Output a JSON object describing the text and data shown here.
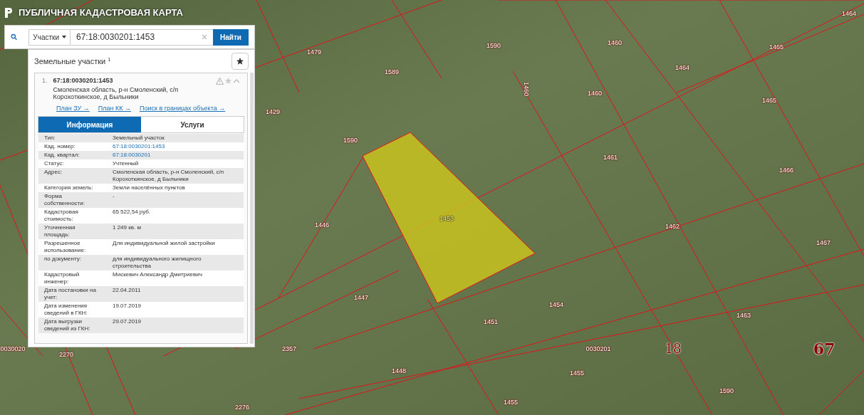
{
  "app": {
    "title": "ПУБЛИЧНАЯ КАДАСТРОВАЯ КАРТА"
  },
  "search": {
    "category": "Участки",
    "value": "67:18:0030201:1453",
    "button": "Найти"
  },
  "results": {
    "heading": "Земельные участки $^{1}$",
    "item": {
      "number": "1.",
      "cad_number": "67:18:0030201:1453",
      "address": "Смоленская область, р-н Смоленский, с/п Корохоткинское, д Быльники",
      "links": [
        "План ЗУ →",
        "План КК →",
        "Поиск в границах объекта →"
      ],
      "tabs": [
        {
          "label": "Информация",
          "selected": true
        },
        {
          "label": "Услуги",
          "selected": false
        }
      ],
      "rows": [
        {
          "label": "Тип:",
          "value": "Земельный участок",
          "kind": "text"
        },
        {
          "label": "Кад. номер:",
          "value": "67:18:0030201:1453",
          "kind": "link"
        },
        {
          "label": "Кад. квартал:",
          "value": "67:18:0030201",
          "kind": "link"
        },
        {
          "label": "Статус:",
          "value": "Учтенный",
          "kind": "text"
        },
        {
          "label": "Адрес:",
          "value": "Смоленская область, р-н Смоленский, с/п Корохоткинское, д Быльники",
          "kind": "text"
        },
        {
          "label": "Категория земель:",
          "value": "Земли населённых пунктов",
          "kind": "text"
        },
        {
          "label": "Форма собственности:",
          "value": "-",
          "kind": "text"
        },
        {
          "label": "Кадастровая стоимость:",
          "value": "65 522,54 руб.",
          "kind": "text"
        },
        {
          "label": "Уточненная площадь:",
          "value": "1 249 кв. м",
          "kind": "text"
        },
        {
          "label": "Разрешенное использование:",
          "value": "Для индивидуальной жилой застройки",
          "kind": "text"
        },
        {
          "label": "по документу:",
          "value": "для индивидуального жилищного строительства",
          "kind": "text"
        },
        {
          "label": "Кадастровый инженер:",
          "value": "Мискевич Александр Дмитриевич",
          "kind": "text"
        },
        {
          "label": "Дата постановки на учет:",
          "value": "22.04.2011",
          "kind": "text"
        },
        {
          "label": "Дата изменения сведений в ГКН:",
          "value": "19.07.2019",
          "kind": "text"
        },
        {
          "label": "Дата выгрузки сведений из ГКН:",
          "value": "29.07.2019",
          "kind": "text"
        }
      ]
    }
  },
  "map": {
    "parcel_labels": [
      {
        "text": "1464",
        "kind": "parcel"
      },
      {
        "text": "1460",
        "kind": "parcel"
      },
      {
        "text": "1465",
        "kind": "parcel"
      },
      {
        "text": "1590",
        "kind": "parcel"
      },
      {
        "text": "1479",
        "kind": "parcel"
      },
      {
        "text": "1589",
        "kind": "parcel"
      },
      {
        "text": "1464",
        "kind": "parcel"
      },
      {
        "text": "1429",
        "kind": "parcel"
      },
      {
        "text": "1460",
        "kind": "parcel"
      },
      {
        "text": "1460",
        "kind": "parcel"
      },
      {
        "text": "1465",
        "kind": "parcel"
      },
      {
        "text": "1590",
        "kind": "parcel"
      },
      {
        "text": "1461",
        "kind": "parcel"
      },
      {
        "text": "1466",
        "kind": "parcel"
      },
      {
        "text": "1453",
        "kind": "selected"
      },
      {
        "text": "1446",
        "kind": "parcel"
      },
      {
        "text": "1462",
        "kind": "parcel"
      },
      {
        "text": "1467",
        "kind": "parcel"
      },
      {
        "text": "1447",
        "kind": "parcel"
      },
      {
        "text": "1454",
        "kind": "parcel"
      },
      {
        "text": "1451",
        "kind": "parcel"
      },
      {
        "text": "1463",
        "kind": "parcel"
      },
      {
        "text": "0030020",
        "kind": "parcel"
      },
      {
        "text": "2270",
        "kind": "parcel"
      },
      {
        "text": "2357",
        "kind": "parcel"
      },
      {
        "text": "0030201",
        "kind": "parcel"
      },
      {
        "text": "18",
        "kind": "district"
      },
      {
        "text": "67",
        "kind": "region"
      },
      {
        "text": "1448",
        "kind": "parcel"
      },
      {
        "text": "1455",
        "kind": "parcel"
      },
      {
        "text": "1590",
        "kind": "parcel"
      },
      {
        "text": "1455",
        "kind": "parcel"
      },
      {
        "text": "2276",
        "kind": "parcel"
      }
    ]
  }
}
